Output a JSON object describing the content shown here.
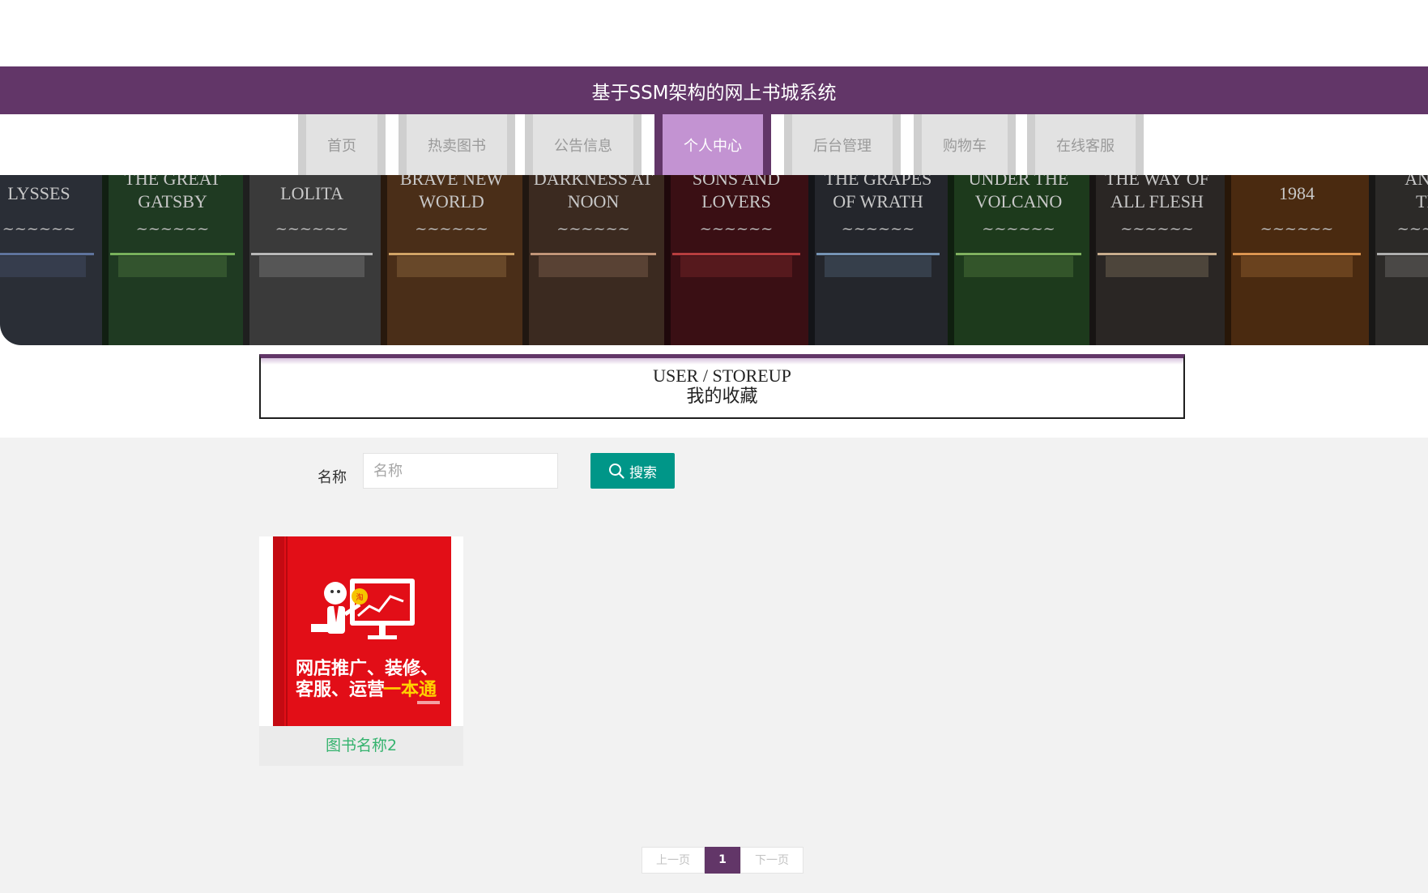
{
  "header": {
    "title": "基于SSM架构的网上书城系统"
  },
  "nav": {
    "items": [
      {
        "label": "首页"
      },
      {
        "label": "热卖图书"
      },
      {
        "label": "公告信息"
      },
      {
        "label": "个人中心"
      },
      {
        "label": "后台管理"
      },
      {
        "label": "购物车"
      },
      {
        "label": "在线客服"
      }
    ],
    "active_index": 3
  },
  "banner": {
    "spines": [
      "LYSSES",
      "THE GREAT GATSBY",
      "LOLITA",
      "BRAVE NEW WORLD",
      "DARKNESS AT NOON",
      "SONS AND LOVERS",
      "THE GRAPES OF WRATH",
      "UNDER THE VOLCANO",
      "THE WAY OF ALL FLESH",
      "1984",
      "AN AM TRA"
    ]
  },
  "breadcrumb": {
    "en": "USER / STOREUP",
    "cn": "我的收藏"
  },
  "search": {
    "label": "名称",
    "placeholder": "名称",
    "value": "",
    "button_label": "搜索"
  },
  "items": [
    {
      "name": "图书名称2",
      "cover_text_line1": "网店推广、装修、",
      "cover_text_line2": "客服、运营",
      "cover_highlight": "一本通"
    }
  ],
  "pagination": {
    "prev": "上一页",
    "current": "1",
    "next": "下一页"
  },
  "colors": {
    "brand": "#623668",
    "active_tab": "#c393d2",
    "search_button": "#009688",
    "item_title": "#35b36e"
  }
}
